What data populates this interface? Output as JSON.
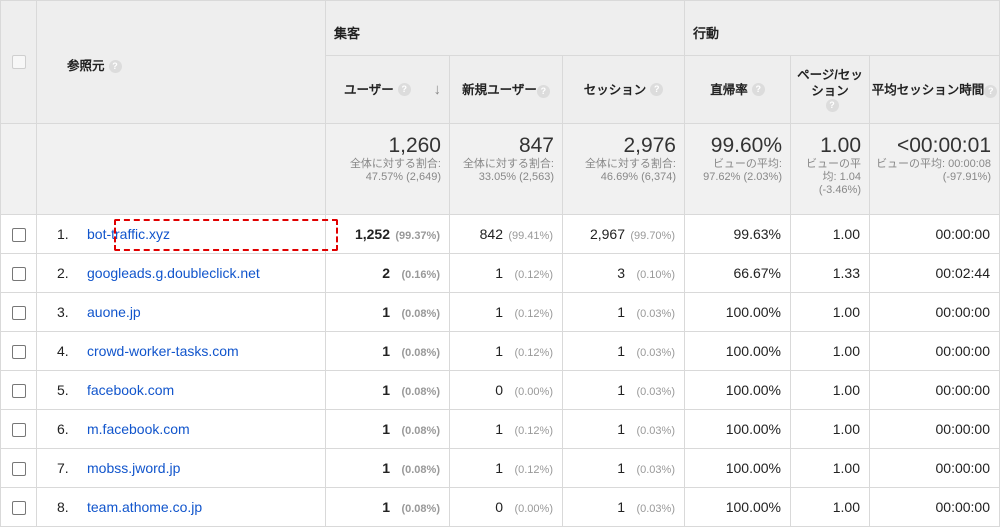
{
  "header": {
    "source_label": "参照元",
    "acquisition_label": "集客",
    "behavior_label": "行動",
    "help_glyph": "?",
    "sort_arrow": "↓",
    "columns": {
      "users": "ユーザー",
      "new_users": "新規ユーザー",
      "sessions": "セッション",
      "bounce_rate": "直帰率",
      "pages_per_session": "ページ/セッション",
      "avg_session_duration": "平均セッション時間"
    }
  },
  "totals": {
    "users": {
      "value": "1,260",
      "sub": "全体に対する割合: 47.57% (2,649)"
    },
    "new_users": {
      "value": "847",
      "sub": "全体に対する割合: 33.05% (2,563)"
    },
    "sessions": {
      "value": "2,976",
      "sub": "全体に対する割合: 46.69% (6,374)"
    },
    "bounce_rate": {
      "value": "99.60%",
      "sub": "ビューの平均: 97.62% (2.03%)"
    },
    "pages_per_session": {
      "value": "1.00",
      "sub": "ビューの平均: 1.04 (-3.46%)"
    },
    "avg_session_duration": {
      "value": "<00:00:01",
      "sub": "ビューの平均: 00:00:08 (-97.91%)"
    }
  },
  "rows": [
    {
      "num": "1.",
      "source": "bot-traffic.xyz",
      "users": "1,252",
      "users_pct": "(99.37%)",
      "new_users": "842",
      "new_users_pct": "(99.41%)",
      "sessions": "2,967",
      "sessions_pct": "(99.70%)",
      "bounce": "99.63%",
      "pages": "1.00",
      "duration": "00:00:00"
    },
    {
      "num": "2.",
      "source": "googleads.g.doubleclick.net",
      "users": "2",
      "users_pct": "(0.16%)",
      "new_users": "1",
      "new_users_pct": "(0.12%)",
      "sessions": "3",
      "sessions_pct": "(0.10%)",
      "bounce": "66.67%",
      "pages": "1.33",
      "duration": "00:02:44"
    },
    {
      "num": "3.",
      "source": "auone.jp",
      "users": "1",
      "users_pct": "(0.08%)",
      "new_users": "1",
      "new_users_pct": "(0.12%)",
      "sessions": "1",
      "sessions_pct": "(0.03%)",
      "bounce": "100.00%",
      "pages": "1.00",
      "duration": "00:00:00"
    },
    {
      "num": "4.",
      "source": "crowd-worker-tasks.com",
      "users": "1",
      "users_pct": "(0.08%)",
      "new_users": "1",
      "new_users_pct": "(0.12%)",
      "sessions": "1",
      "sessions_pct": "(0.03%)",
      "bounce": "100.00%",
      "pages": "1.00",
      "duration": "00:00:00"
    },
    {
      "num": "5.",
      "source": "facebook.com",
      "users": "1",
      "users_pct": "(0.08%)",
      "new_users": "0",
      "new_users_pct": "(0.00%)",
      "sessions": "1",
      "sessions_pct": "(0.03%)",
      "bounce": "100.00%",
      "pages": "1.00",
      "duration": "00:00:00"
    },
    {
      "num": "6.",
      "source": "m.facebook.com",
      "users": "1",
      "users_pct": "(0.08%)",
      "new_users": "1",
      "new_users_pct": "(0.12%)",
      "sessions": "1",
      "sessions_pct": "(0.03%)",
      "bounce": "100.00%",
      "pages": "1.00",
      "duration": "00:00:00"
    },
    {
      "num": "7.",
      "source": "mobss.jword.jp",
      "users": "1",
      "users_pct": "(0.08%)",
      "new_users": "1",
      "new_users_pct": "(0.12%)",
      "sessions": "1",
      "sessions_pct": "(0.03%)",
      "bounce": "100.00%",
      "pages": "1.00",
      "duration": "00:00:00"
    },
    {
      "num": "8.",
      "source": "team.athome.co.jp",
      "users": "1",
      "users_pct": "(0.08%)",
      "new_users": "0",
      "new_users_pct": "(0.00%)",
      "sessions": "1",
      "sessions_pct": "(0.03%)",
      "bounce": "100.00%",
      "pages": "1.00",
      "duration": "00:00:00"
    }
  ],
  "colors": {
    "link": "#1155cc",
    "highlight": "#e00000",
    "header_bg": "#eeeeee"
  }
}
